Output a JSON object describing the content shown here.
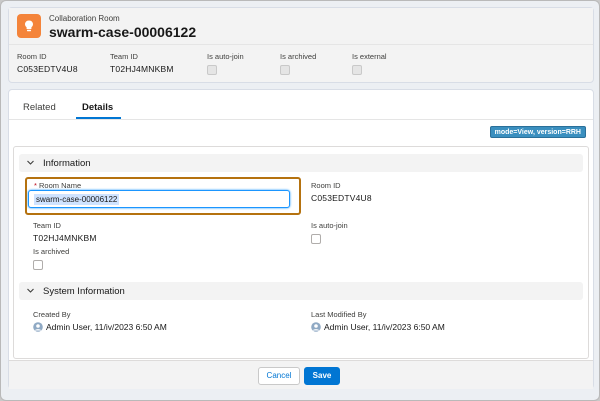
{
  "header": {
    "object_label": "Collaboration Room",
    "title": "swarm-case-00006122",
    "fields": [
      {
        "label": "Room ID",
        "value": "C053EDTV4U8"
      },
      {
        "label": "Team ID",
        "value": "T02HJ4MNKBM"
      },
      {
        "label": "Is auto-join",
        "value": ""
      },
      {
        "label": "Is archived",
        "value": ""
      },
      {
        "label": "Is external",
        "value": ""
      }
    ]
  },
  "tabs": [
    {
      "label": "Related"
    },
    {
      "label": "Details",
      "active": true
    }
  ],
  "mode_badge": "mode=View, version=RRH",
  "sections": {
    "information": {
      "title": "Information",
      "room_name": {
        "required_mark": "*",
        "label": "Room Name",
        "value": "swarm-case-00006122"
      },
      "room_id": {
        "label": "Room ID",
        "value": "C053EDTV4U8"
      },
      "team_id": {
        "label": "Team ID",
        "value": "T02HJ4MNKBM"
      },
      "is_auto_join": {
        "label": "Is auto-join"
      },
      "is_archived": {
        "label": "Is archived"
      }
    },
    "system": {
      "title": "System Information",
      "created_by": {
        "label": "Created By",
        "value": "Admin User, 11/iv/2023 6:50 AM"
      },
      "last_modified_by": {
        "label": "Last Modified By",
        "value": "Admin User, 11/iv/2023 6:50 AM"
      }
    }
  },
  "footer": {
    "cancel_label": "Cancel",
    "save_label": "Save"
  },
  "colors": {
    "brand_blue": "#0176d3",
    "record_icon": "#f4843a",
    "focus_ring": "#b5720f"
  }
}
